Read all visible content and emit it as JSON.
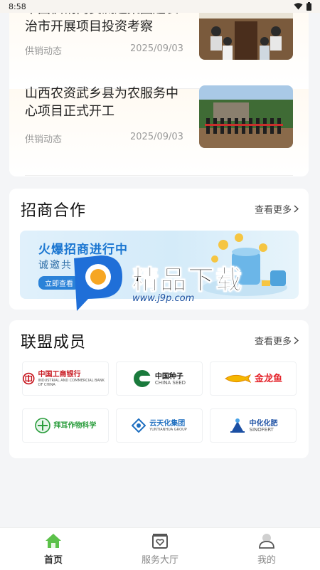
{
  "status_bar": {
    "time": "8:58"
  },
  "news": [
    {
      "title": "中国供销商贸流通集团赴长治市开展项目投资考察",
      "tag": "供销动态",
      "date": "2025/09/03"
    },
    {
      "title": "山西农资武乡县为农服务中心项目正式开工",
      "tag": "供销动态",
      "date": "2025/09/03"
    }
  ],
  "investment": {
    "title": "招商合作",
    "more": "查看更多",
    "banner": {
      "headline": "火爆招商进行中",
      "subline": "诚邀共 事业",
      "button": "立即查看"
    }
  },
  "members": {
    "title": "联盟成员",
    "more": "查看更多",
    "items": [
      {
        "name": "中国工商银行",
        "sub": "INDUSTRIAL AND COMMERCIAL BANK OF CHINA",
        "color": "#c7161e",
        "icon": "icbc-logo"
      },
      {
        "name": "中国种子",
        "sub": "CHINA SEED",
        "color": "#1a7a3c",
        "icon": "china-seed-logo"
      },
      {
        "name": "金龙鱼",
        "sub": "",
        "color": "#e4242b",
        "icon": "arowana-logo"
      },
      {
        "name": "拜耳作物科学",
        "sub": "",
        "color": "#2a9d3c",
        "icon": "bayer-logo"
      },
      {
        "name": "云天化集团",
        "sub": "YUNTIANHUA GROUP",
        "color": "#1f6fc0",
        "icon": "yuntianhua-logo"
      },
      {
        "name": "中化化肥",
        "sub": "SINOFERT",
        "color": "#1b4fa3",
        "icon": "sinofert-logo"
      }
    ]
  },
  "watermark": {
    "text": "精品下载",
    "url": "www.j9p.com"
  },
  "tabs": [
    {
      "label": "首页",
      "icon": "home-icon",
      "active": true
    },
    {
      "label": "服务大厅",
      "icon": "service-hall-icon",
      "active": false
    },
    {
      "label": "我的",
      "icon": "profile-icon",
      "active": false
    }
  ],
  "colors": {
    "accent_green": "#5cc14a",
    "banner_blue": "#1b76d1"
  }
}
